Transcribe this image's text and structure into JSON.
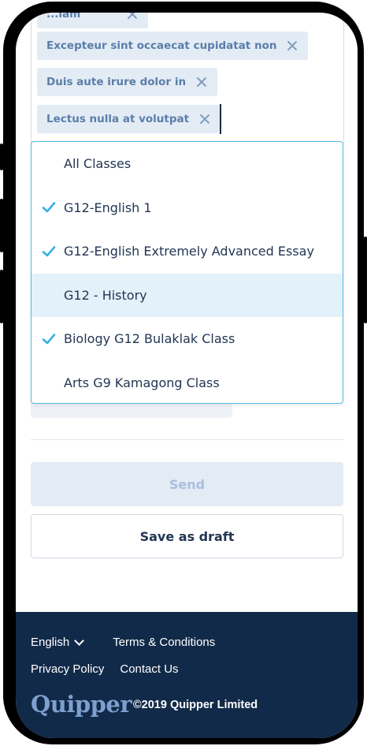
{
  "tags": {
    "partial_top": "...iam",
    "items": [
      "Excepteur sint occaecat cupidatat non",
      "Duis aute irure dolor in",
      "Lectus nulla at volutpat"
    ]
  },
  "dropdown": {
    "options": [
      {
        "label": "All Classes",
        "checked": false,
        "highlighted": false
      },
      {
        "label": "G12-English 1",
        "checked": true,
        "highlighted": false
      },
      {
        "label": "G12-English Extremely Advanced Essay",
        "checked": true,
        "highlighted": false
      },
      {
        "label": "G12 - History",
        "checked": false,
        "highlighted": true
      },
      {
        "label": "Biology G12 Bulaklak Class",
        "checked": true,
        "highlighted": false
      },
      {
        "label": "Arts G9 Kamagong Class",
        "checked": false,
        "highlighted": false
      }
    ]
  },
  "actions": {
    "send_label": "Send",
    "draft_label": "Save as draft"
  },
  "footer": {
    "language": "English",
    "terms": "Terms & Conditions",
    "privacy": "Privacy Policy",
    "contact": "Contact Us",
    "logo_text": "Quipper",
    "copyright": "©2019 Quipper Limited"
  },
  "colors": {
    "accent": "#35b1e8",
    "footer_bg": "#122a49",
    "tag_bg": "#e3ebf5",
    "highlight_bg": "#e3f1fa"
  }
}
